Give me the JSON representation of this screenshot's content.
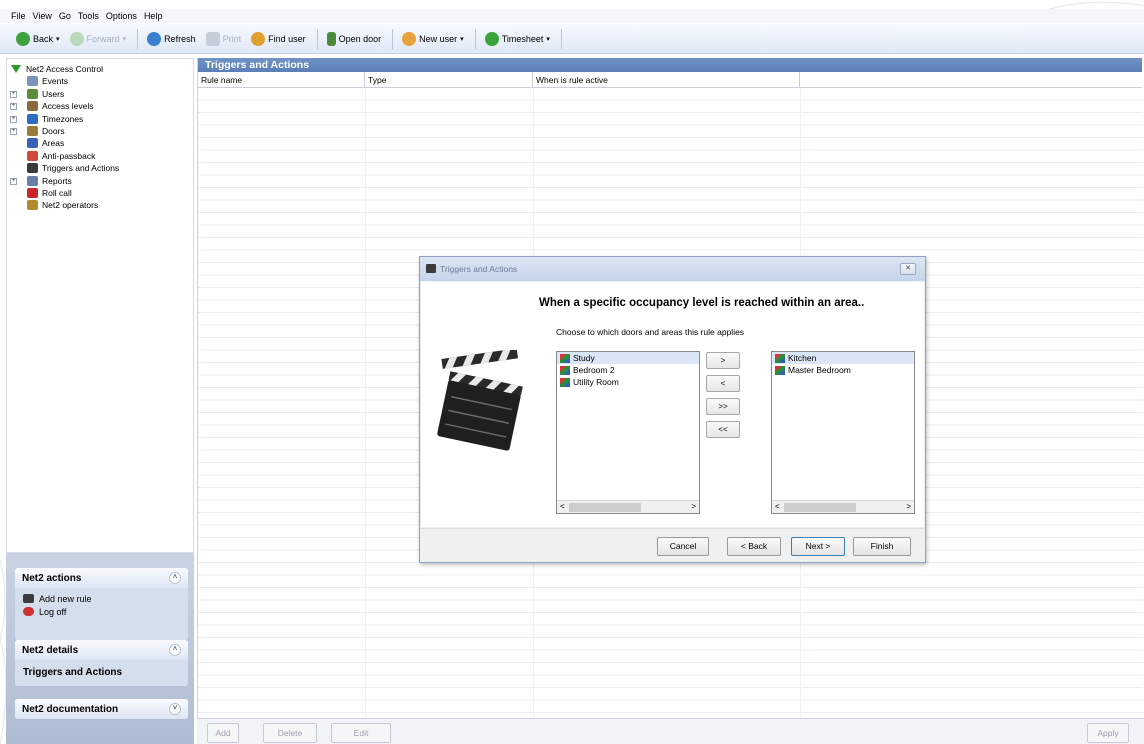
{
  "menubar": {
    "items": [
      "File",
      "View",
      "Go",
      "Tools",
      "Options",
      "Help"
    ]
  },
  "toolbar": {
    "back": "Back",
    "forward": "Forward",
    "refresh": "Refresh",
    "print": "Print",
    "find_user": "Find user",
    "open_door": "Open door",
    "new_user": "New user",
    "timesheet": "Timesheet"
  },
  "tree": {
    "items": [
      {
        "label": "Net2 Access Control",
        "icon": "net2-root-icon",
        "color": "#2e9a2e",
        "expandable": false,
        "indent": 0
      },
      {
        "label": "Events",
        "icon": "events-icon",
        "color": "#7a93b8",
        "expandable": false,
        "indent": 1
      },
      {
        "label": "Users",
        "icon": "users-icon",
        "color": "#5c8e3a",
        "expandable": true,
        "indent": 1
      },
      {
        "label": "Access levels",
        "icon": "access-levels-icon",
        "color": "#8a6a3c",
        "expandable": true,
        "indent": 1
      },
      {
        "label": "Timezones",
        "icon": "timezones-icon",
        "color": "#2d6ec4",
        "expandable": true,
        "indent": 1
      },
      {
        "label": "Doors",
        "icon": "doors-icon",
        "color": "#9a7a3a",
        "expandable": true,
        "indent": 1
      },
      {
        "label": "Areas",
        "icon": "areas-icon",
        "color": "#3a62b8",
        "expandable": false,
        "indent": 1
      },
      {
        "label": "Anti-passback",
        "icon": "anti-passback-icon",
        "color": "#d04a3a",
        "expandable": false,
        "indent": 1
      },
      {
        "label": "Triggers and Actions",
        "icon": "triggers-actions-icon",
        "color": "#3a3a3a",
        "expandable": false,
        "indent": 1
      },
      {
        "label": "Reports",
        "icon": "reports-icon",
        "color": "#6a7fa8",
        "expandable": true,
        "indent": 1
      },
      {
        "label": "Roll call",
        "icon": "roll-call-icon",
        "color": "#c8282d",
        "expandable": false,
        "indent": 1
      },
      {
        "label": "Net2 operators",
        "icon": "net2-operators-icon",
        "color": "#b08a2e",
        "expandable": false,
        "indent": 1
      }
    ]
  },
  "panels": {
    "actions": {
      "title": "Net2 actions",
      "add_rule": "Add new rule",
      "log_off": "Log off"
    },
    "details": {
      "title": "Net2 details",
      "value": "Triggers and Actions"
    },
    "documentation": {
      "title": "Net2 documentation"
    }
  },
  "content": {
    "title": "Triggers and Actions",
    "columns": [
      "Rule name",
      "Type",
      "When is rule active"
    ]
  },
  "bottom": {
    "add": "Add",
    "delete": "Delete",
    "edit": "Edit",
    "apply": "Apply"
  },
  "dialog": {
    "title": "Triggers and Actions",
    "heading": "When a specific occupancy level is reached within an area..",
    "subheading": "Choose to which doors and areas this rule applies",
    "left_items": [
      "Study",
      "Bedroom 2",
      "Utility Room"
    ],
    "right_items": [
      "Kitchen",
      "Master Bedroom"
    ],
    "move_right": ">",
    "move_left": "<",
    "move_all_right": ">>",
    "move_all_left": "<<",
    "cancel": "Cancel",
    "back": "< Back",
    "next": "Next >",
    "finish": "Finish"
  }
}
